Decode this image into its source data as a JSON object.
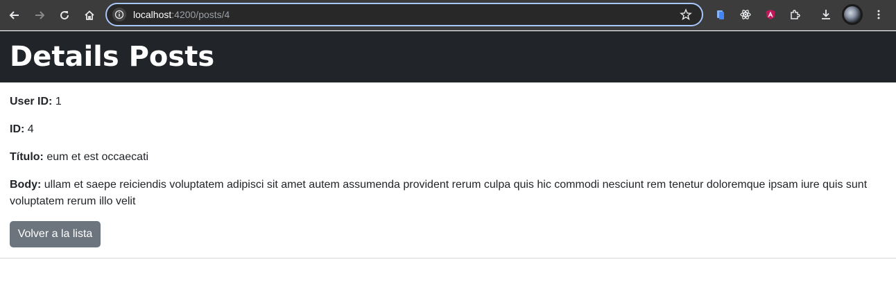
{
  "browser": {
    "url_host": "localhost",
    "url_rest": ":4200/posts/4"
  },
  "page": {
    "title": "Details Posts",
    "fields": {
      "user_id_label": "User ID:",
      "user_id_value": "1",
      "id_label": "ID:",
      "id_value": "4",
      "titulo_label": "Título:",
      "titulo_value": "eum et est occaecati",
      "body_label": "Body:",
      "body_value": "ullam et saepe reiciendis voluptatem adipisci sit amet autem assumenda provident rerum culpa quis hic commodi nesciunt rem tenetur doloremque ipsam iure quis sunt voluptatem rerum illo velit"
    },
    "back_button": "Volver a la lista"
  },
  "colors": {
    "header_bg": "#212529",
    "button_bg": "#6c757d",
    "toolbar_bg": "#3c3c3c",
    "omnibox_border": "#a8c7fa"
  }
}
